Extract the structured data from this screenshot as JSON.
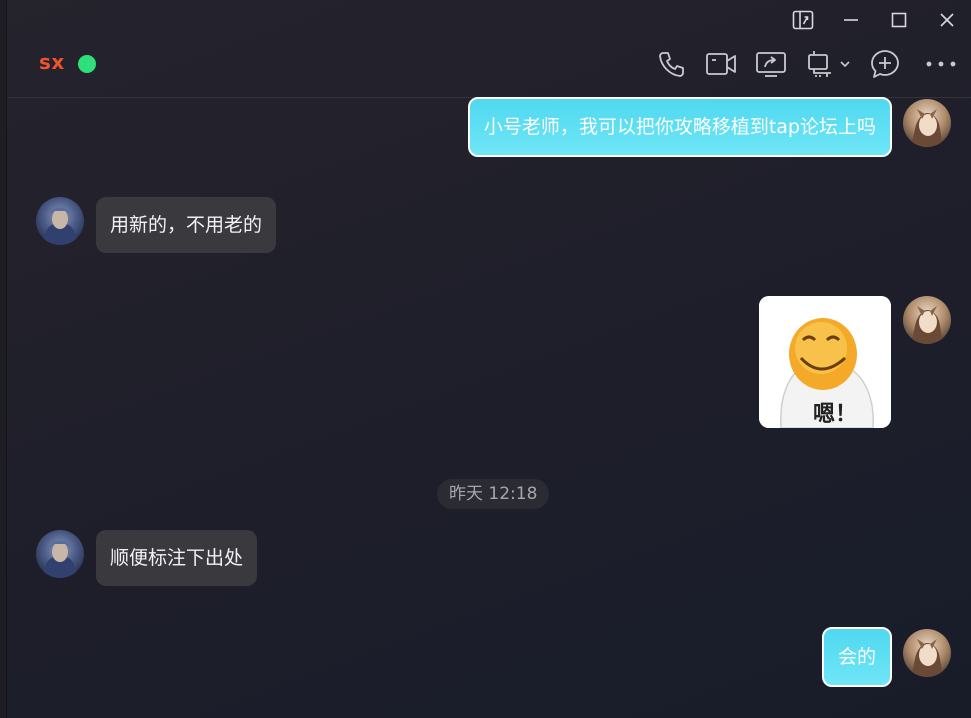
{
  "window": {
    "controls": {
      "pin_icon": "pin-window-icon",
      "minimize_icon": "minimize-icon",
      "maximize_icon": "maximize-icon",
      "close_icon": "close-icon"
    }
  },
  "header": {
    "contact_name": "sx",
    "status_color": "#2ee07a",
    "toolbar": [
      "phone-icon",
      "video-call-icon",
      "screen-share-icon",
      "screenshot-icon",
      "add-member-icon",
      "more-icon"
    ]
  },
  "messages": [
    {
      "side": "sent",
      "type": "text",
      "text": "小号老师，我可以把你攻略移植到tap论坛上吗"
    },
    {
      "side": "received",
      "type": "text",
      "text": "用新的，不用老的"
    },
    {
      "side": "sent",
      "type": "sticker",
      "sticker_text": "嗯！"
    },
    {
      "type": "timestamp",
      "text": "昨天 12:18"
    },
    {
      "side": "received",
      "type": "text",
      "text": "顺便标注下出处"
    },
    {
      "side": "sent",
      "type": "text",
      "text": "会的"
    }
  ],
  "colors": {
    "sent_bubble": "#5edff3",
    "received_bubble": "#3a3a3e",
    "contact_name": "#f0522d"
  }
}
